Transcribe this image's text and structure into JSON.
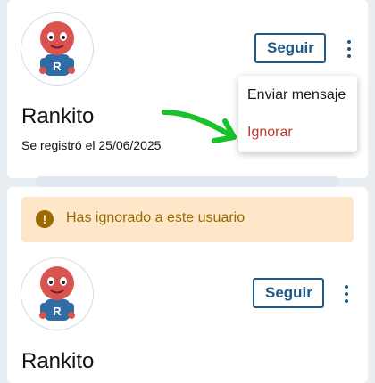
{
  "profile_top": {
    "username": "Rankito",
    "joined": "Se registró el 25/06/2025",
    "follow_label": "Seguir"
  },
  "menu": {
    "items": [
      {
        "label": "Enviar mensaje"
      },
      {
        "label": "Ignorar"
      }
    ]
  },
  "alert": {
    "icon": "!",
    "text": "Has ignorado a este usuario"
  },
  "profile_bottom": {
    "username": "Rankito",
    "follow_label": "Seguir"
  },
  "colors": {
    "accent": "#1f5a86",
    "danger": "#c0392b",
    "warning_bg": "#fde7c8",
    "warning_text": "#9a6a00",
    "annotation_arrow": "#17c22a"
  }
}
